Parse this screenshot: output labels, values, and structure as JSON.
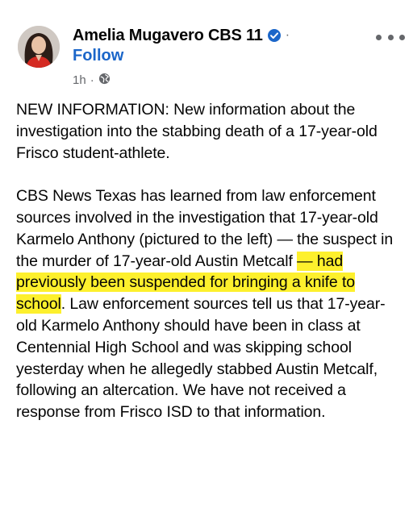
{
  "post": {
    "author": "Amelia Mugavero CBS 11",
    "follow_label": "Follow",
    "timestamp": "1h",
    "separator": "·",
    "name_separator": "·",
    "verified_icon": "verified-badge-icon",
    "audience_icon": "globe-icon",
    "more_icon": "more-options-icon",
    "highlight_color": "#fdf02d",
    "link_color": "#1b66c9",
    "paragraph1": "NEW INFORMATION: New information about the investigation into the stabbing death of a 17-year-old Frisco student-athlete.",
    "paragraph2_before": "CBS News Texas has learned from law enforcement sources involved in the investigation that 17-year-old Karmelo Anthony (pictured to the left) — the suspect in the murder of 17-year-old Austin Metcalf ",
    "paragraph2_highlight": "— had previously been suspended for bringing a knife to school",
    "paragraph2_after": ". Law enforcement sources tell us that 17-year-old Karmelo Anthony should have been in class at Centennial High School and was skipping school yesterday when he allegedly stabbed Austin Metcalf, following an altercation. We have not received a response from Frisco ISD to that information."
  }
}
